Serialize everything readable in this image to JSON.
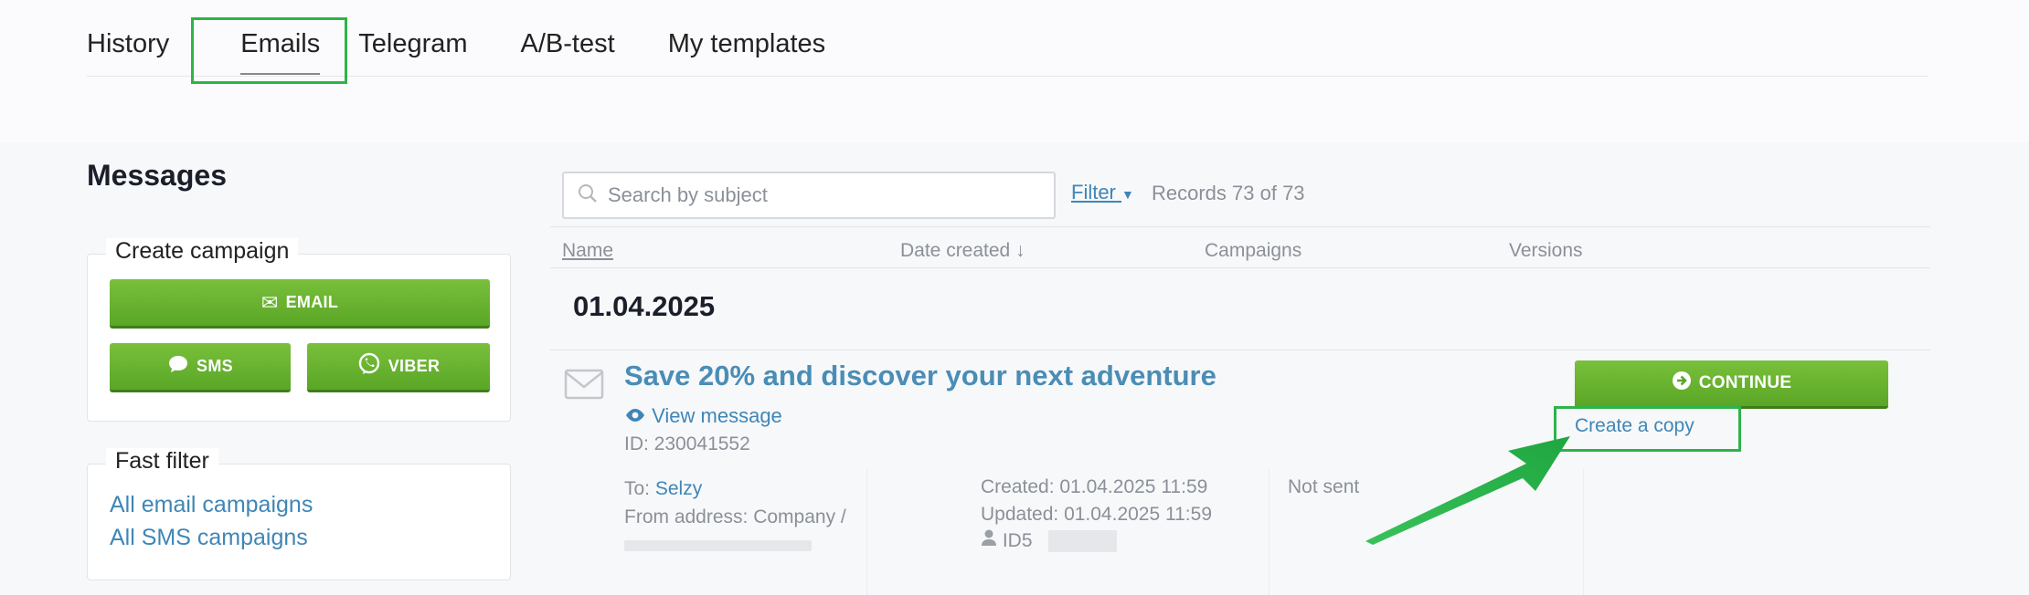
{
  "tabs": [
    {
      "label": "History"
    },
    {
      "label": "Emails"
    },
    {
      "label": "Telegram"
    },
    {
      "label": "A/B-test"
    },
    {
      "label": "My templates"
    }
  ],
  "sidebar": {
    "title": "Messages",
    "create_campaign": {
      "legend": "Create campaign",
      "email_label": "EMAIL",
      "sms_label": "SMS",
      "viber_label": "VIBER"
    },
    "fast_filter": {
      "legend": "Fast filter",
      "links": [
        "All email campaigns",
        "All SMS campaigns"
      ]
    }
  },
  "toolbar": {
    "search_placeholder": "Search by subject",
    "filter_label": "Filter",
    "records": "Records 73 of 73"
  },
  "table": {
    "columns": [
      "Name",
      "Date created ↓",
      "Campaigns",
      "Versions"
    ],
    "date_group": "01.04.2025",
    "message": {
      "subject": "Save 20% and discover your next adventure",
      "view_link": "View message",
      "id": "ID: 230041552",
      "to_label": "To:",
      "to_value": "Selzy",
      "from_label": "From address: Company /",
      "created": "Created: 01.04.2025 11:59",
      "updated": "Updated: 01.04.2025 11:59",
      "user_id_prefix": "ID5",
      "status": "Not sent",
      "continue_label": "CONTINUE",
      "copy_label": "Create a copy"
    }
  },
  "colors": {
    "accent_green": "#5aa626",
    "highlight_green": "#2fb34a",
    "link_blue": "#3f86b6"
  }
}
